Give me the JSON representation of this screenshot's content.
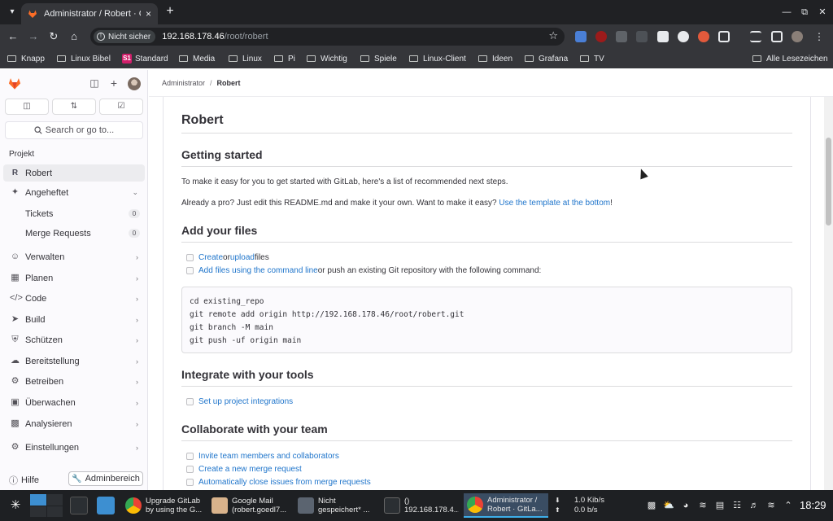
{
  "browser": {
    "tab_title": "Administrator / Robert · GitLab",
    "secure_chip": "Nicht sicher",
    "url_host": "192.168.178.46",
    "url_path": "/root/robert",
    "bookmarks": [
      "Knapp",
      "Linux Bibel",
      "Standard",
      "Media",
      "Linux",
      "Pi",
      "Wichtig",
      "Spiele",
      "Linux-Client",
      "Ideen",
      "Grafana",
      "TV"
    ],
    "bookmark_badge": "S1",
    "all_bookmarks": "Alle Lesezeichen"
  },
  "sidebar": {
    "search_label": "Search or go to...",
    "section_label": "Projekt",
    "project_name": "Robert",
    "project_initial": "R",
    "pinned_label": "Angeheftet",
    "pinned_items": [
      {
        "label": "Tickets",
        "count": "0"
      },
      {
        "label": "Merge Requests",
        "count": "0"
      }
    ],
    "nav_items": [
      "Verwalten",
      "Planen",
      "Code",
      "Build",
      "Schützen",
      "Bereitstellung",
      "Betreiben",
      "Überwachen",
      "Analysieren",
      "Einstellungen"
    ],
    "help_label": "Hilfe",
    "admin_label": "Adminbereich"
  },
  "breadcrumb": {
    "parent": "Administrator",
    "separator": "/",
    "current": "Robert"
  },
  "readme": {
    "title": "Robert",
    "getting_started": {
      "heading": "Getting started",
      "intro": "To make it easy for you to get started with GitLab, here's a list of recommended next steps.",
      "pro_text": "Already a pro? Just edit this README.md and make it your own. Want to make it easy? ",
      "pro_link": "Use the template at the bottom",
      "pro_end": "!"
    },
    "add_files": {
      "heading": "Add your files",
      "task1_link1": "Create",
      "task1_or": " or ",
      "task1_link2": "upload",
      "task1_end": " files",
      "task2_link": "Add files using the command line",
      "task2_end": " or push an existing Git repository with the following command:",
      "code_lines": [
        "cd existing_repo",
        "git remote add origin http://192.168.178.46/root/robert.git",
        "git branch -M main",
        "git push -uf origin main"
      ]
    },
    "integrate": {
      "heading": "Integrate with your tools",
      "task1_link": "Set up project integrations"
    },
    "collaborate": {
      "heading": "Collaborate with your team",
      "tasks": [
        "Invite team members and collaborators",
        "Create a new merge request",
        "Automatically close issues from merge requests"
      ]
    }
  },
  "taskbar": {
    "tasks": [
      {
        "line1": "Upgrade GitLab",
        "line2": "by using the G..."
      },
      {
        "line1": "Google Mail",
        "line2": "(robert.goedl7..."
      },
      {
        "line1": "Nicht",
        "line2": "gespeichert* ..."
      },
      {
        "line1": "()",
        "line2": "192.168.178.4..."
      },
      {
        "line1": "Administrator /",
        "line2": "Robert · GitLa..."
      }
    ],
    "net_down": "1.0 Kib/s",
    "net_up": "0.0 b/s",
    "clock": "18:29"
  },
  "colors": {
    "link": "#1f75cb",
    "gitlab_orange": "#fc6d26",
    "task_active": "#3a4d63"
  }
}
